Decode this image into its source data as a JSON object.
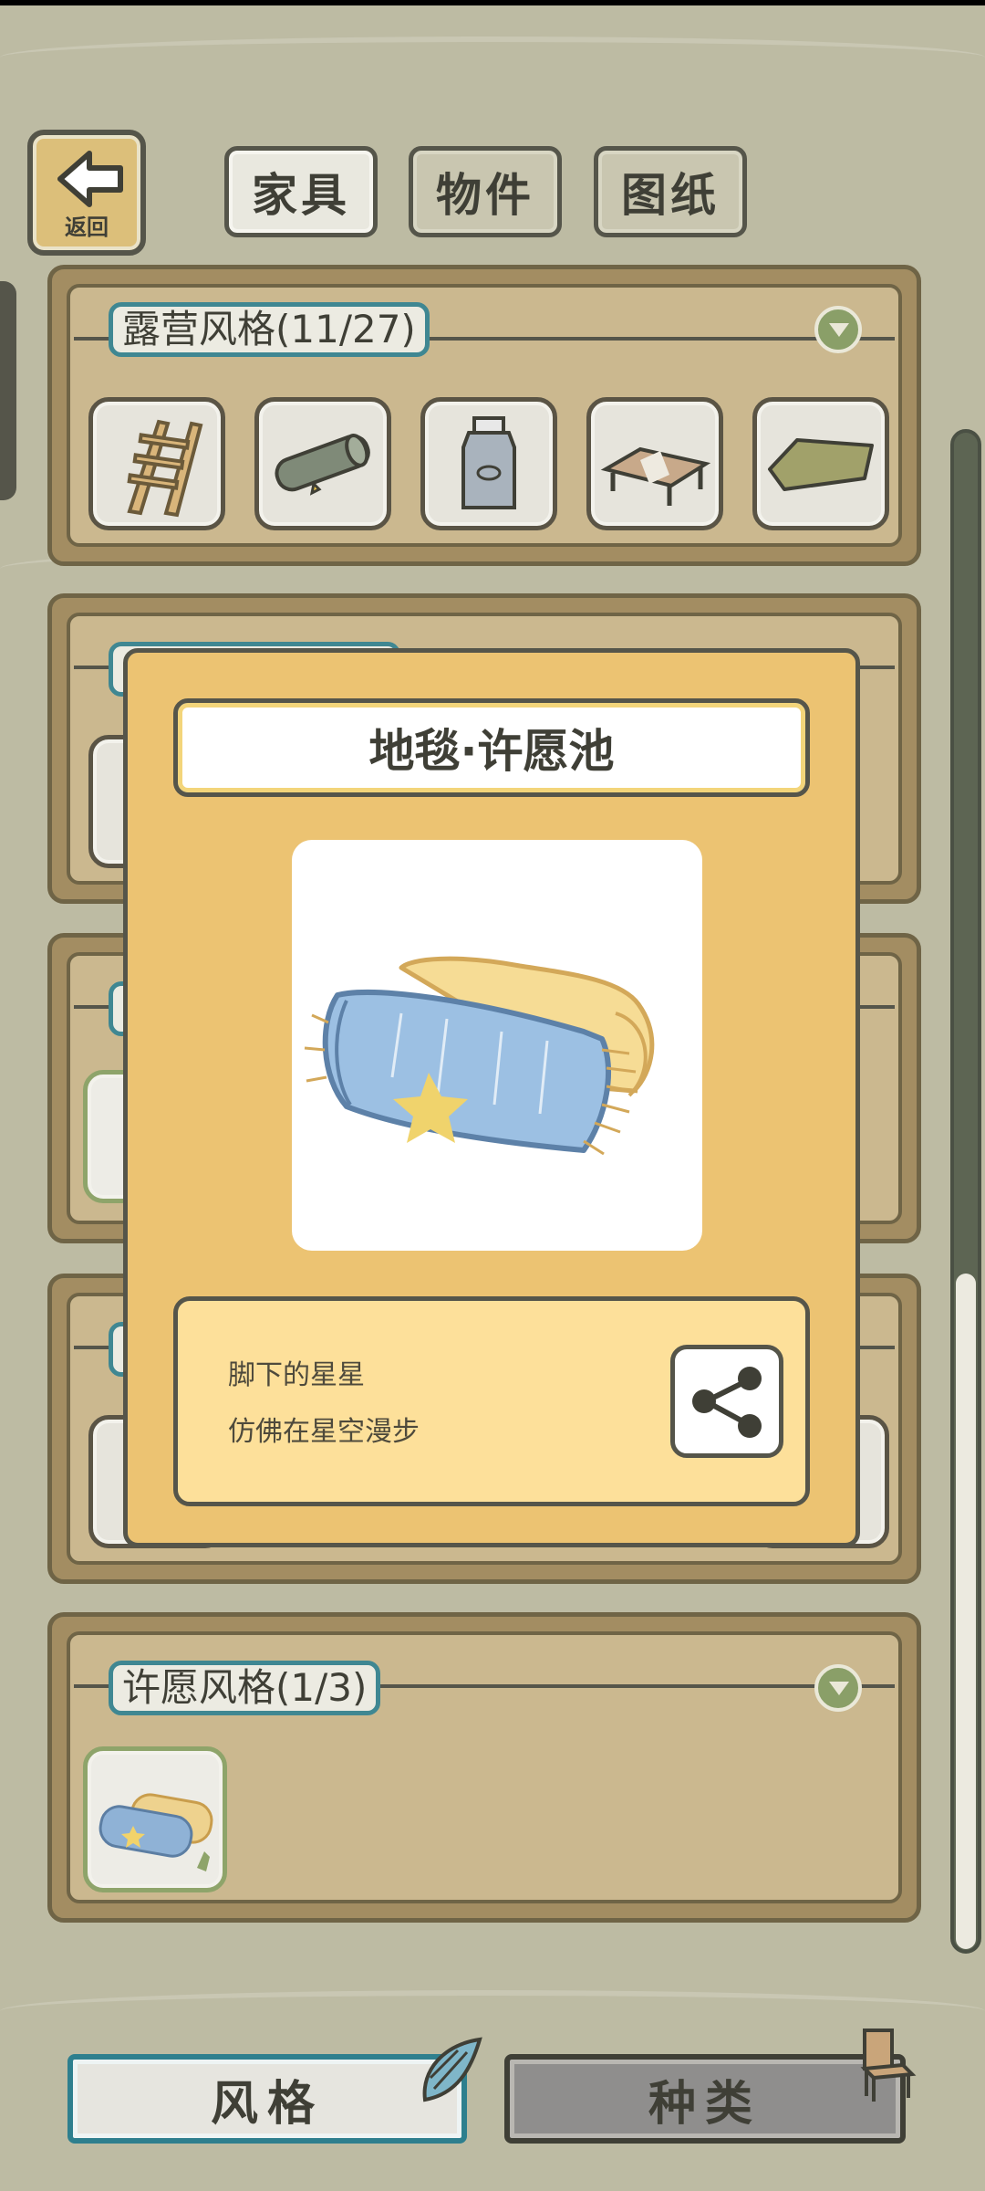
{
  "nav": {
    "back_label": "返回",
    "tabs": [
      {
        "label": "家具"
      },
      {
        "label": "物件"
      },
      {
        "label": "图纸"
      }
    ]
  },
  "sections": [
    {
      "title": "露营风格(11/27)",
      "icon": "chevron-down-icon",
      "items": [
        "ladder-icon",
        "rolled-mat-icon",
        "canister-icon",
        "low-table-icon",
        "cushion-icon"
      ]
    },
    {
      "title": "",
      "icon": "chevron-down-icon"
    },
    {
      "title": "",
      "icon": "chevron-down-icon"
    },
    {
      "title": "",
      "icon": "chevron-down-icon"
    },
    {
      "title": "许愿风格(1/3)",
      "icon": "chevron-down-icon",
      "items": [
        "rolled-rug-icon"
      ]
    }
  ],
  "modal": {
    "title": "地毯·许愿池",
    "description_line1": "脚下的星星",
    "description_line2": "仿佛在星空漫步",
    "share_icon": "share-icon"
  },
  "bottom_tabs": [
    {
      "label": "风格",
      "active": true
    },
    {
      "label": "种类",
      "active": false
    }
  ],
  "colors": {
    "accent_teal": "#3f8792",
    "modal_bg": "#ecc372",
    "desc_bg": "#fde09a",
    "owned_green": "#8ea46a"
  }
}
